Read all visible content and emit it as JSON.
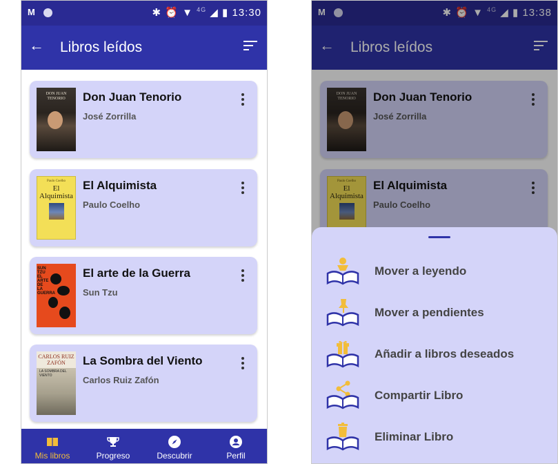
{
  "status": {
    "time_left": "13:30",
    "time_right": "13:38",
    "network": "4G"
  },
  "appbar": {
    "title": "Libros leídos"
  },
  "books": [
    {
      "title": "Don Juan Tenorio",
      "author": "José Zorrilla",
      "cover_text": "DON JUAN TENORIO"
    },
    {
      "title": "El Alquimista",
      "author": "Paulo Coelho",
      "cover_author": "Paulo Coelho",
      "cover_title": "El Alquimista"
    },
    {
      "title": "El arte de la Guerra",
      "author": "Sun Tzu",
      "cover_text": "SUN TZU EL ARTE DE LA GUERRA"
    },
    {
      "title": "La Sombra del Viento",
      "author": "Carlos Ruiz Zafón",
      "cover_author": "CARLOS RUIZ ZAFÓN",
      "cover_title": "LA SOMBRA DEL VIENTO"
    }
  ],
  "nav": [
    {
      "label": "Mis libros",
      "icon": "book-icon",
      "active": true
    },
    {
      "label": "Progreso",
      "icon": "trophy-icon",
      "active": false
    },
    {
      "label": "Descubrir",
      "icon": "compass-icon",
      "active": false
    },
    {
      "label": "Perfil",
      "icon": "person-icon",
      "active": false
    }
  ],
  "sheet": {
    "items": [
      {
        "label": "Mover a leyendo",
        "icon": "reading-person-icon"
      },
      {
        "label": "Mover a pendientes",
        "icon": "pin-icon"
      },
      {
        "label": "Añadir a libros deseados",
        "icon": "gift-icon"
      },
      {
        "label": "Compartir Libro",
        "icon": "share-icon"
      },
      {
        "label": "Eliminar Libro",
        "icon": "trash-icon"
      }
    ]
  },
  "colors": {
    "primary": "#2f33a8",
    "statusbar": "#2a2a93",
    "card": "#d4d4f9",
    "accent": "#f2bd3a"
  }
}
